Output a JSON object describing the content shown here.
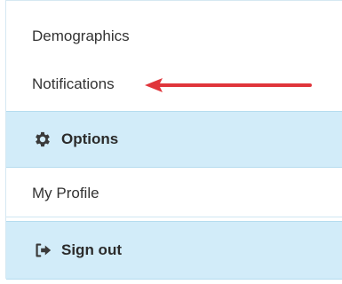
{
  "menu": {
    "items": [
      {
        "label": "Demographics"
      },
      {
        "label": "Notifications"
      },
      {
        "label": "Options"
      },
      {
        "label": "My Profile"
      },
      {
        "label": "Sign out"
      }
    ],
    "icons": {
      "options": "gear-icon",
      "sign_out": "sign-out-icon"
    },
    "colors": {
      "header_bg": "#d2ecf9",
      "arrow": "#e0353b",
      "text": "#333333"
    }
  }
}
